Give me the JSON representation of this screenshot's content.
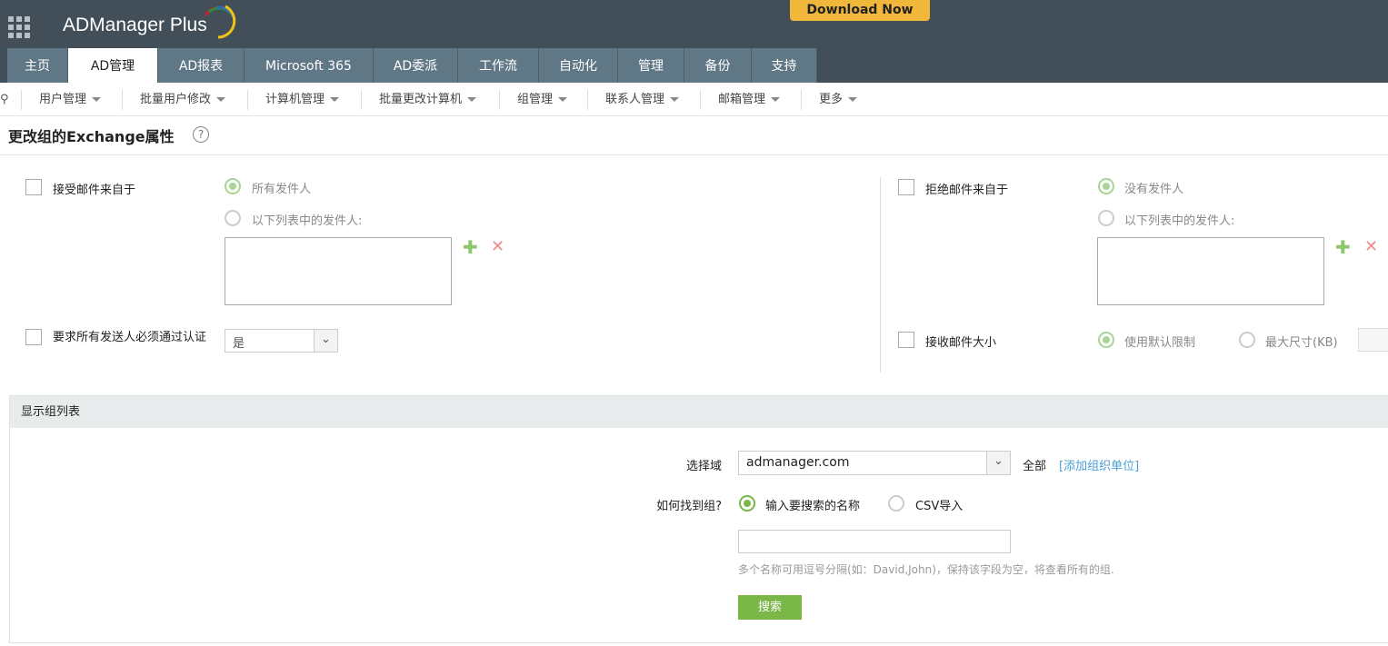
{
  "header": {
    "app_name": "ADManager Plus",
    "download_label": "Download Now"
  },
  "tabs": [
    "主页",
    "AD管理",
    "AD报表",
    "Microsoft 365",
    "AD委派",
    "工作流",
    "自动化",
    "管理",
    "备份",
    "支持"
  ],
  "submenu": [
    "用户管理",
    "批量用户修改",
    "计算机管理",
    "批量更改计算机",
    "组管理",
    "联系人管理",
    "邮箱管理",
    "更多"
  ],
  "page": {
    "title": "更改组的Exchange属性",
    "help": "?"
  },
  "left": {
    "accept_label": "接受邮件来自于",
    "opt_all": "所有发件人",
    "opt_list": "以下列表中的发件人:",
    "auth_label": "要求所有发送人必须通过认证",
    "auth_value": "是"
  },
  "right": {
    "reject_label": "拒绝邮件来自于",
    "opt_none": "没有发件人",
    "opt_list": "以下列表中的发件人:",
    "size_label": "接收邮件大小",
    "opt_default": "使用默认限制",
    "opt_max": "最大尺寸(KB)"
  },
  "panel": {
    "title": "显示组列表",
    "domain_label": "选择域",
    "domain_value": "admanager.com",
    "all": "全部",
    "add_ou": "[添加组织单位]",
    "find_label": "如何找到组?",
    "opt_name": "输入要搜索的名称",
    "opt_csv": "CSV导入",
    "hint": "多个名称可用逗号分隔(如：David,John)，保持该字段为空，将查看所有的组.",
    "search": "搜索"
  }
}
